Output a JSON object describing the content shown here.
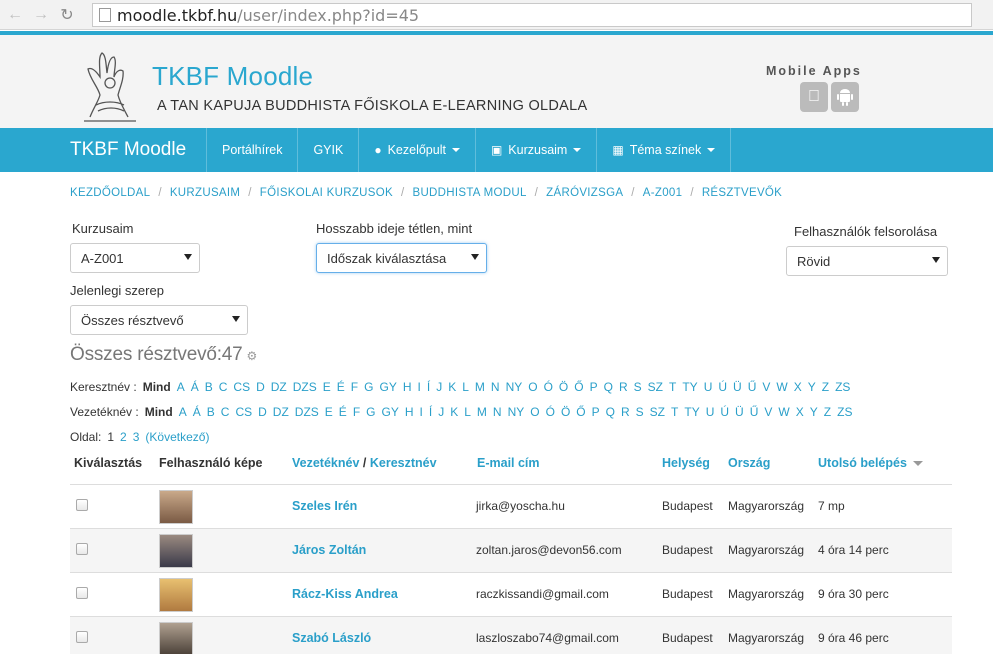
{
  "browser": {
    "url_host": "moodle.tkbf.hu",
    "url_path": "/user/index.php?id=45"
  },
  "header": {
    "title": "TKBF Moodle",
    "subtitle": "A TAN KAPUJA BUDDHISTA FŐISKOLA E-LEARNING OLDALA",
    "mobile_apps": "Mobile Apps"
  },
  "navbar": {
    "brand": "TKBF Moodle",
    "items": [
      {
        "label": "Portálhírek"
      },
      {
        "label": "GYIK"
      },
      {
        "label": "Kezelőpult",
        "icon": "dashboard-icon"
      },
      {
        "label": "Kurzusaim",
        "icon": "briefcase-icon"
      },
      {
        "label": "Téma színek",
        "icon": "grid-icon"
      }
    ]
  },
  "breadcrumb": [
    "KEZDŐOLDAL",
    "KURZUSAIM",
    "FŐISKOLAI KURZUSOK",
    "BUDDHISTA MODUL",
    "ZÁRÓVIZSGA",
    "A-Z001",
    "RÉSZTVEVŐK"
  ],
  "filters": {
    "course_label": "Kurzusaim",
    "course_value": "A-Z001",
    "inactive_label": "Hosszabb ideje tétlen, mint",
    "inactive_value": "Időszak kiválasztása",
    "listing_label": "Felhasználók felsorolása",
    "listing_value": "Rövid",
    "role_label": "Jelenlegi szerep",
    "role_value": "Összes résztvevő"
  },
  "total": "Összes résztvevő:47",
  "initials": {
    "first_label": "Keresztnév :",
    "last_label": "Vezetéknév :",
    "all": "Mind",
    "letters": [
      "A",
      "Á",
      "B",
      "C",
      "CS",
      "D",
      "DZ",
      "DZS",
      "E",
      "É",
      "F",
      "G",
      "GY",
      "H",
      "I",
      "Í",
      "J",
      "K",
      "L",
      "M",
      "N",
      "NY",
      "O",
      "Ó",
      "Ö",
      "Ő",
      "P",
      "Q",
      "R",
      "S",
      "SZ",
      "T",
      "TY",
      "U",
      "Ú",
      "Ü",
      "Ű",
      "V",
      "W",
      "X",
      "Y",
      "Z",
      "ZS"
    ]
  },
  "pager": {
    "label": "Oldal:",
    "current": "1",
    "pages": [
      "2",
      "3"
    ],
    "next": "(Következő)"
  },
  "table": {
    "headers": {
      "select": "Kiválasztás",
      "picture": "Felhasználó képe",
      "lastname": "Vezetéknév",
      "slash": "/",
      "firstname": "Keresztnév",
      "email": "E-mail cím",
      "city": "Helység",
      "country": "Ország",
      "lastaccess": "Utolsó belépés"
    },
    "rows": [
      {
        "name": "Szeles Irén",
        "email": "jirka@yoscha.hu",
        "city": "Budapest",
        "country": "Magyarország",
        "lastaccess": "7 mp"
      },
      {
        "name": "Járos Zoltán",
        "email": "zoltan.jaros@devon56.com",
        "city": "Budapest",
        "country": "Magyarország",
        "lastaccess": "4 óra 14 perc"
      },
      {
        "name": "Rácz-Kiss Andrea",
        "email": "raczkissandi@gmail.com",
        "city": "Budapest",
        "country": "Magyarország",
        "lastaccess": "9 óra 30 perc"
      },
      {
        "name": "Szabó László",
        "email": "laszloszabo74@gmail.com",
        "city": "Budapest",
        "country": "Magyarország",
        "lastaccess": "9 óra 46 perc"
      }
    ]
  }
}
